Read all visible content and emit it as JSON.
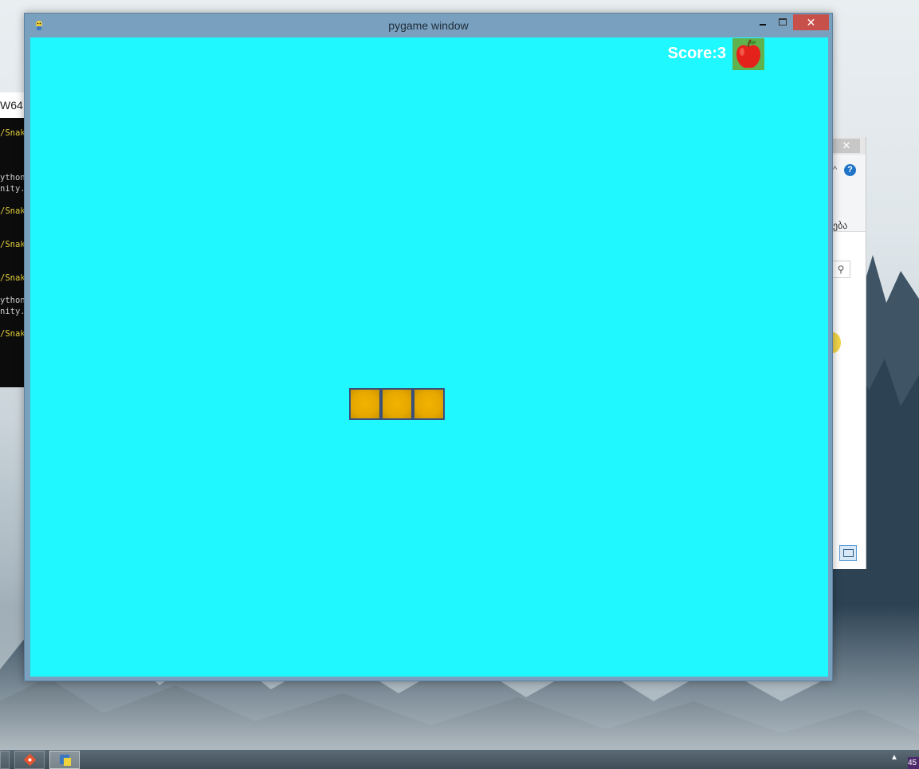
{
  "window": {
    "title": "pygame window",
    "close_label": "✕"
  },
  "game": {
    "score_text": "Score:3",
    "background_color": "#1ff8ff",
    "snake_color": "#e6a800",
    "apple_tile_color": "#5fb34f",
    "apple_icon": "apple-icon",
    "snake_segments": 3
  },
  "console": {
    "title_fragment": "W64",
    "lines": [
      {
        "text": "/Snak",
        "color": "yellow"
      },
      {
        "text": "ython",
        "color": "white"
      },
      {
        "text": "nity.",
        "color": "white"
      },
      {
        "text": "/Snak",
        "color": "yellow"
      },
      {
        "text": "/Snak",
        "color": "yellow"
      },
      {
        "text": "/Snak",
        "color": "yellow"
      },
      {
        "text": "ython",
        "color": "white"
      },
      {
        "text": "nity.",
        "color": "white"
      },
      {
        "text": "/Snak",
        "color": "yellow"
      }
    ]
  },
  "explorer": {
    "close_label": "✕",
    "help_label": "?",
    "text_fragment": "ება",
    "search_icon": "search-icon"
  },
  "taskbar": {
    "clock_fragment": "45"
  }
}
